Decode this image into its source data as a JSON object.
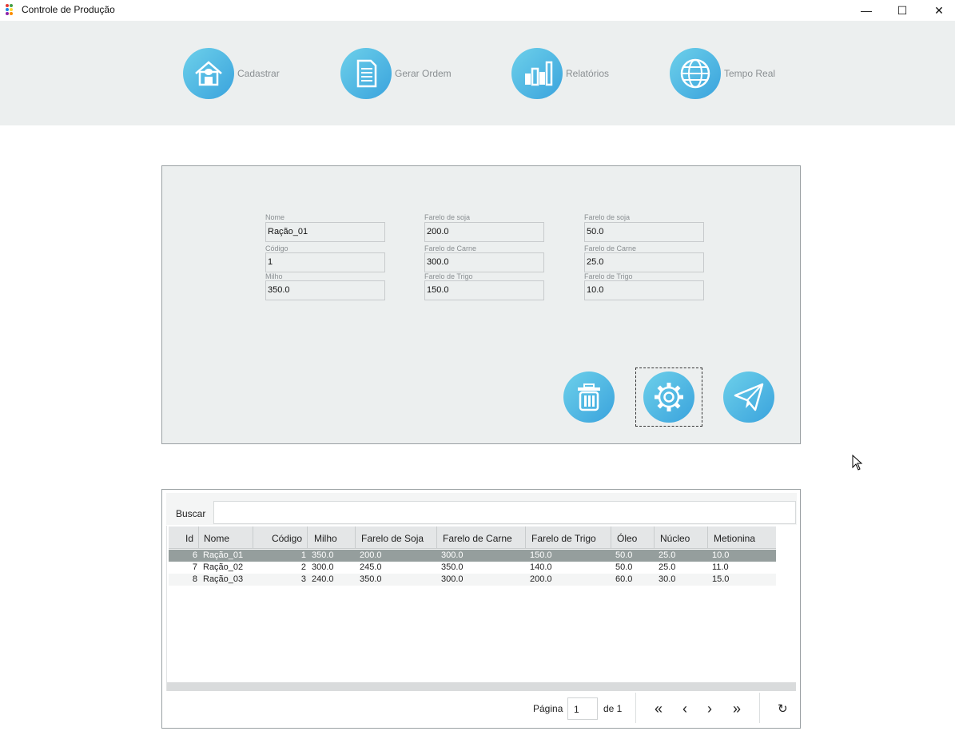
{
  "window": {
    "title": "Controle de Produção",
    "minimize": "—",
    "maximize": "☐",
    "close": "✕"
  },
  "nav": [
    {
      "label": "Cadastrar",
      "icon": "house-icon"
    },
    {
      "label": "Gerar Ordem",
      "icon": "document-icon"
    },
    {
      "label": "Relatórios",
      "icon": "bar-chart-icon"
    },
    {
      "label": "Tempo Real",
      "icon": "globe-icon"
    }
  ],
  "form": {
    "nome": {
      "label": "Nome",
      "value": "Ração_01"
    },
    "codigo": {
      "label": "Código",
      "value": "1"
    },
    "milho": {
      "label": "Milho",
      "value": "350.0"
    },
    "soja1": {
      "label": "Farelo de soja",
      "value": "200.0"
    },
    "carne1": {
      "label": "Farelo de Carne",
      "value": "300.0"
    },
    "trigo1": {
      "label": "Farelo de Trigo",
      "value": "150.0"
    },
    "soja2": {
      "label": "Farelo de soja",
      "value": "50.0"
    },
    "carne2": {
      "label": "Farelo de Carne",
      "value": "25.0"
    },
    "trigo2": {
      "label": "Farelo de Trigo",
      "value": "10.0"
    }
  },
  "actions": {
    "delete": "trash-icon",
    "settings": "gear-icon",
    "send": "paper-plane-icon"
  },
  "search": {
    "label": "Buscar",
    "value": ""
  },
  "table": {
    "headers": [
      "Id",
      "Nome",
      "Código",
      "Milho",
      "Farelo de Soja",
      "Farelo de Carne",
      "Farelo de Trigo",
      "Óleo",
      "Núcleo",
      "Metionina"
    ],
    "rows": [
      [
        "6",
        "Ração_01",
        "1",
        "350.0",
        "200.0",
        "300.0",
        "150.0",
        "50.0",
        "25.0",
        "10.0"
      ],
      [
        "7",
        "Ração_02",
        "2",
        "300.0",
        "245.0",
        "350.0",
        "140.0",
        "50.0",
        "25.0",
        "11.0"
      ],
      [
        "8",
        "Ração_03",
        "3",
        "240.0",
        "350.0",
        "300.0",
        "200.0",
        "60.0",
        "30.0",
        "15.0"
      ]
    ],
    "selected_row": 0
  },
  "pager": {
    "page_label": "Página",
    "page_value": "1",
    "of_label": "de 1",
    "first": "«",
    "prev": "‹",
    "next": "›",
    "last": "»",
    "refresh": "↻"
  }
}
